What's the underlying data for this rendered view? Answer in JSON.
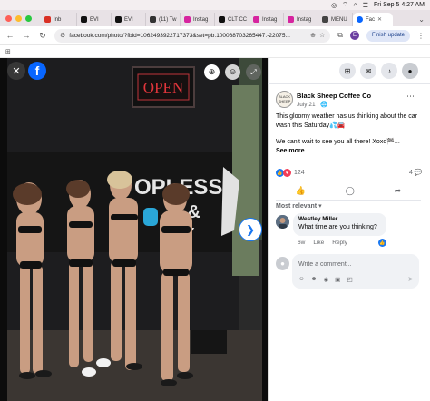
{
  "menubar": {
    "status_icons": [
      "chrome-icon",
      "wifi-icon",
      "search-icon",
      "control-center-icon"
    ],
    "datetime": "Fri Sep 5  4:27 AM"
  },
  "tabs": [
    {
      "label": "Inb",
      "favicon": "gmail-icon",
      "color": "#d93025"
    },
    {
      "label": "EVI",
      "favicon": "x-icon",
      "color": "#111111"
    },
    {
      "label": "EVI",
      "favicon": "x-icon",
      "color": "#111111"
    },
    {
      "label": "(11) Tw",
      "favicon": "twitch-icon",
      "color": "#333333"
    },
    {
      "label": "Instag",
      "favicon": "instagram-icon",
      "color": "#d6249f"
    },
    {
      "label": "CLT CC",
      "favicon": "threads-icon",
      "color": "#111111"
    },
    {
      "label": "Instag",
      "favicon": "instagram-icon",
      "color": "#d6249f"
    },
    {
      "label": "Instag",
      "favicon": "instagram-icon",
      "color": "#d6249f"
    },
    {
      "label": "MENU",
      "favicon": "menu-icon",
      "color": "#444444"
    },
    {
      "label": "Fac",
      "favicon": "facebook-icon",
      "color": "#0866ff",
      "active": true
    }
  ],
  "browser": {
    "url": "facebook.com/photo/?fbid=1062493922717373&set=pb.100068703265447.-22075...",
    "profile_initial": "E",
    "update_label": "Finish update"
  },
  "viewer": {
    "close_icon": "✕",
    "logo_letter": "f",
    "next_icon": "❯"
  },
  "post": {
    "author": "Black Sheep Coffee Co",
    "avatar_text": "BLACK SHEEP",
    "date": "July 21 · 🌐",
    "text_1": "This gloomy weather has us thinking about the car wash this Saturday💦🚘",
    "text_2": "We can't wait to see you all there! Xoxo🏁...",
    "see_more": "See more",
    "reaction_count": "124",
    "comment_count": "4 💬",
    "sort_label": "Most relevant ▾"
  },
  "comment": {
    "name": "Westley Miller",
    "text": "What time are you thinking?",
    "age": "6w",
    "like": "Like",
    "reply": "Reply"
  },
  "composer": {
    "placeholder": "Write a comment..."
  },
  "colors": {
    "facebook_blue": "#0866ff",
    "like_blue": "#1877f2",
    "love_red": "#f33e58"
  }
}
